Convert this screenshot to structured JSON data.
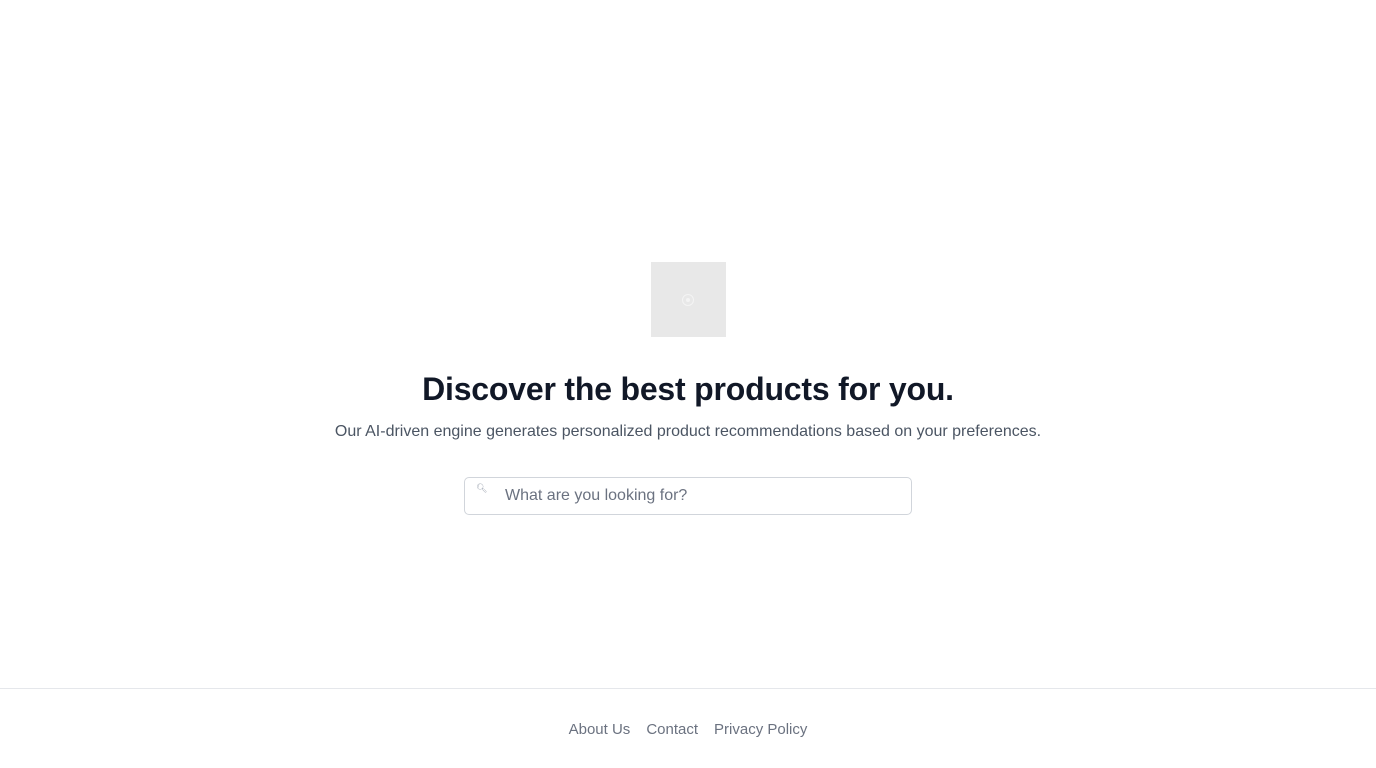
{
  "hero": {
    "logo_icon": "logo-placeholder-icon",
    "headline": "Discover the best products for you.",
    "subtitle": "Our AI-driven engine generates personalized product recommendations based on your preferences."
  },
  "search": {
    "icon": "search-icon",
    "placeholder": "What are you looking for?",
    "value": ""
  },
  "footer": {
    "links": [
      {
        "label": "About Us"
      },
      {
        "label": "Contact"
      },
      {
        "label": "Privacy Policy"
      }
    ]
  }
}
